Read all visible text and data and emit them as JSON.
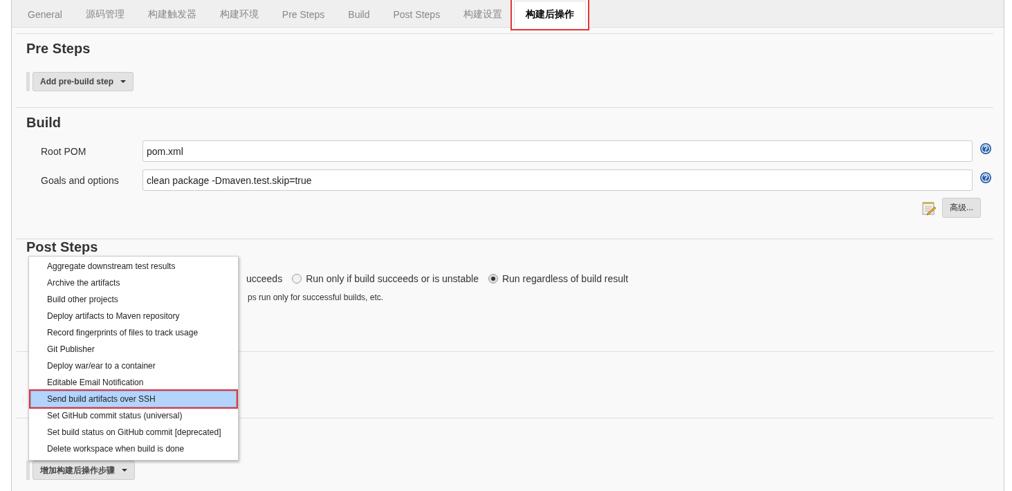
{
  "tabs": [
    {
      "label": "General",
      "selected": false
    },
    {
      "label": "源码管理",
      "selected": false
    },
    {
      "label": "构建触发器",
      "selected": false
    },
    {
      "label": "构建环境",
      "selected": false
    },
    {
      "label": "Pre Steps",
      "selected": false
    },
    {
      "label": "Build",
      "selected": false
    },
    {
      "label": "Post Steps",
      "selected": false
    },
    {
      "label": "构建设置",
      "selected": false
    },
    {
      "label": "构建后操作",
      "selected": true,
      "highlighted": true
    }
  ],
  "pre_steps": {
    "title": "Pre Steps",
    "button": "Add pre-build step"
  },
  "build": {
    "title": "Build",
    "fields": [
      {
        "label": "Root POM",
        "value": "pom.xml"
      },
      {
        "label": "Goals and options",
        "value": "clean package -Dmaven.test.skip=true"
      }
    ],
    "advanced_button": "高级..."
  },
  "post_steps": {
    "title": "Post Steps",
    "partial_label": "ucceeds",
    "radios": [
      {
        "label": "Run only if build succeeds or is unstable",
        "selected": false
      },
      {
        "label": "Run regardless of build result",
        "selected": true
      }
    ],
    "description": "ps run only for successful builds, etc."
  },
  "post_build": {
    "button": "增加构建后操作步骤"
  },
  "menu": {
    "items": [
      {
        "label": "Aggregate downstream test results",
        "selected": false,
        "highlighted": false
      },
      {
        "label": "Archive the artifacts",
        "selected": false,
        "highlighted": false
      },
      {
        "label": "Build other projects",
        "selected": false,
        "highlighted": false
      },
      {
        "label": "Deploy artifacts to Maven repository",
        "selected": false,
        "highlighted": false
      },
      {
        "label": "Record fingerprints of files to track usage",
        "selected": false,
        "highlighted": false
      },
      {
        "label": "Git Publisher",
        "selected": false,
        "highlighted": false
      },
      {
        "label": "Deploy war/ear to a container",
        "selected": false,
        "highlighted": false
      },
      {
        "label": "Editable Email Notification",
        "selected": false,
        "highlighted": false
      },
      {
        "label": "Send build artifacts over SSH",
        "selected": true,
        "highlighted": true
      },
      {
        "label": "Set GitHub commit status (universal)",
        "selected": false,
        "highlighted": false
      },
      {
        "label": "Set build status on GitHub commit [deprecated]",
        "selected": false,
        "highlighted": false
      },
      {
        "label": "Delete workspace when build is done",
        "selected": false,
        "highlighted": false
      }
    ]
  }
}
